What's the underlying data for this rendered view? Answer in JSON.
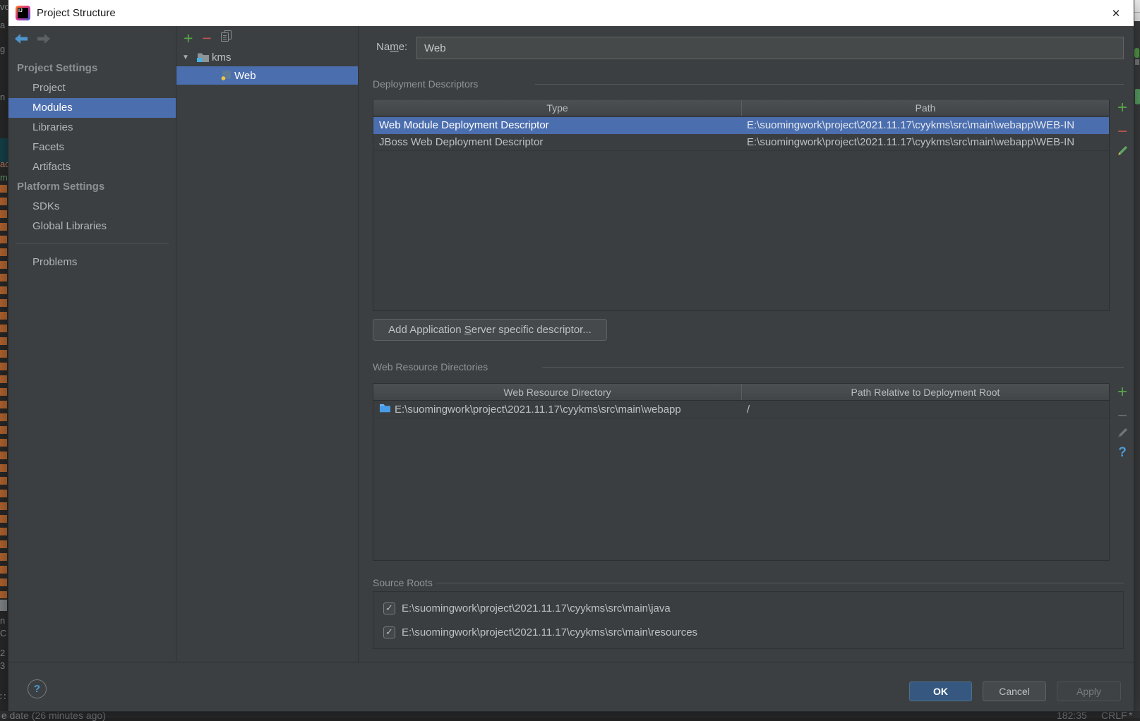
{
  "window": {
    "title": "Project Structure",
    "logo_text": "IJ"
  },
  "icons": {
    "plus": "+",
    "minus": "−",
    "check": "✓",
    "question_mark": "?",
    "close": "✕",
    "expand_arrow": "▼",
    "dots": "∷"
  },
  "colors": {
    "selection_blue": "#4b6eaf",
    "primary_button_blue": "#365880",
    "add_green": "#57a648",
    "remove_red": "#c1544f",
    "help_blue": "#4b9bd5",
    "orange_stripe": "#bf6b32"
  },
  "sidebar": {
    "selected_item": "Modules",
    "sections": [
      {
        "header": "Project Settings",
        "items": [
          "Project",
          "Modules",
          "Libraries",
          "Facets",
          "Artifacts"
        ]
      },
      {
        "header": "Platform Settings",
        "items": [
          "SDKs",
          "Global Libraries"
        ]
      },
      {
        "header": "",
        "items": [
          "Problems"
        ]
      }
    ]
  },
  "tree": {
    "root_label": "kms",
    "child_label": "Web",
    "selected": "Web"
  },
  "form": {
    "name_label": {
      "pre": "Na",
      "mn": "m",
      "post": "e:"
    },
    "name_value": "Web"
  },
  "deployment": {
    "section_title": "Deployment Descriptors",
    "columns": [
      "Type",
      "Path"
    ],
    "rows": [
      {
        "type": "Web Module Deployment Descriptor",
        "path": "E:\\suomingwork\\project\\2021.11.17\\cyykms\\src\\main\\webapp\\WEB-IN",
        "selected": true
      },
      {
        "type": "JBoss Web Deployment Descriptor",
        "path": "E:\\suomingwork\\project\\2021.11.17\\cyykms\\src\\main\\webapp\\WEB-IN",
        "selected": false
      }
    ],
    "add_button": {
      "pre": "Add Application ",
      "mn": "S",
      "post": "erver specific descriptor..."
    }
  },
  "web_resources": {
    "section_title": "Web Resource Directories",
    "columns": [
      "Web Resource Directory",
      "Path Relative to Deployment Root"
    ],
    "rows": [
      {
        "directory": "E:\\suomingwork\\project\\2021.11.17\\cyykms\\src\\main\\webapp",
        "relative_path": "/"
      }
    ]
  },
  "source_roots": {
    "section_title": "Source Roots",
    "items": [
      {
        "path": "E:\\suomingwork\\project\\2021.11.17\\cyykms\\src\\main\\java",
        "checked": true
      },
      {
        "path": "E:\\suomingwork\\project\\2021.11.17\\cyykms\\src\\main\\resources",
        "checked": true
      }
    ]
  },
  "footer": {
    "ok": "OK",
    "cancel": "Cancel",
    "apply": "Apply"
  },
  "background": {
    "left_fragments": {
      "f0": "vo",
      "f1": "a",
      "f2": "g",
      "f3": "n",
      "f4": "ac",
      "f5": "m",
      "f6": "n",
      "f7": "C",
      "f8": "2",
      "f9": "3"
    },
    "status_left": "e date (26 minutes ago)",
    "status_caret": "182:35",
    "status_line_ending": "CRLF",
    "status_modified": "*"
  }
}
